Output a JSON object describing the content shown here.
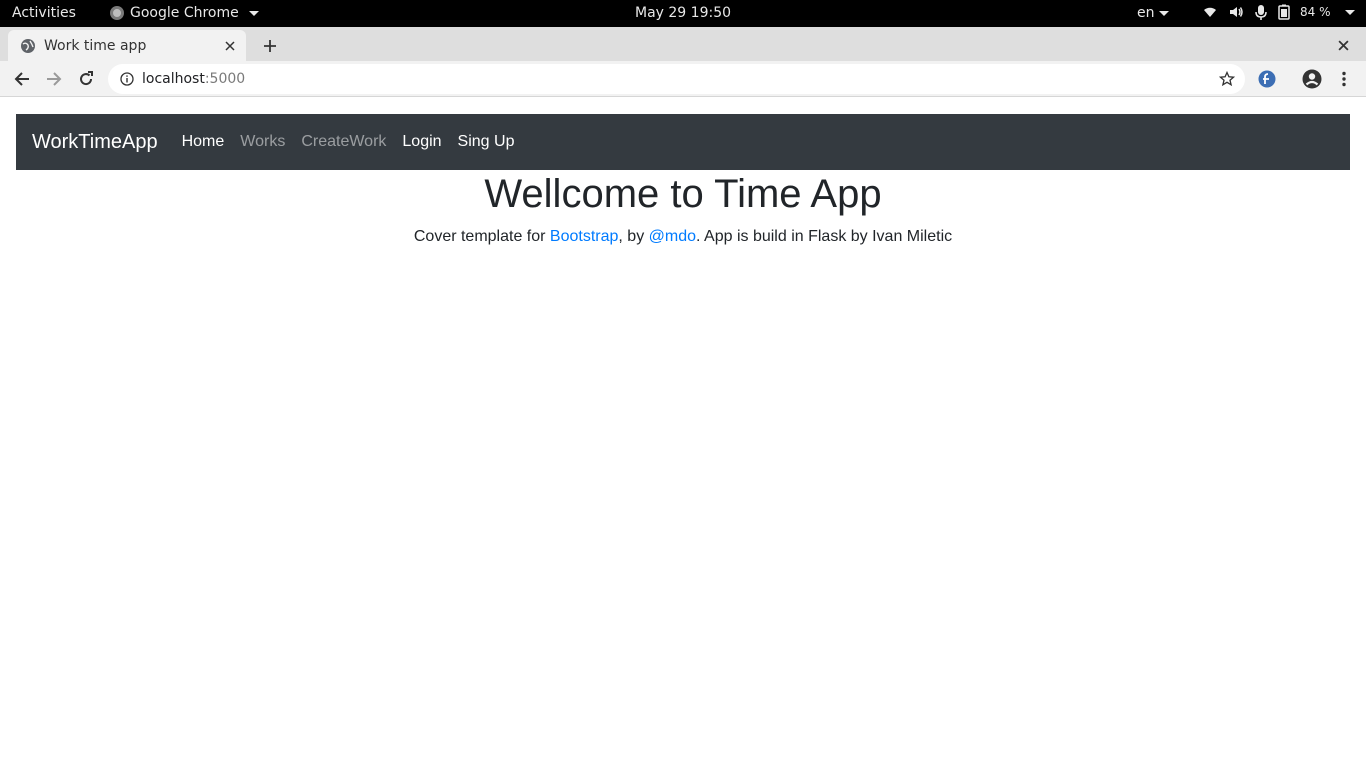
{
  "system_bar": {
    "activities": "Activities",
    "app_name": "Google Chrome",
    "clock": "May 29  19:50",
    "language": "en",
    "battery": "84 %"
  },
  "browser": {
    "tab_title": "Work time app",
    "url_host": "localhost",
    "url_port": ":5000"
  },
  "navbar": {
    "brand": "WorkTimeApp",
    "links": [
      {
        "label": "Home",
        "state": "active"
      },
      {
        "label": "Works",
        "state": "muted"
      },
      {
        "label": "CreateWork",
        "state": "muted"
      },
      {
        "label": "Login",
        "state": "active"
      },
      {
        "label": "Sing Up",
        "state": "active"
      }
    ]
  },
  "main": {
    "title": "Wellcome to Time App",
    "lead_prefix": "Cover template for ",
    "bootstrap_link": "Bootstrap",
    "lead_mid": ", by ",
    "mdo_link": "@mdo",
    "lead_suffix": ". App is build in Flask by Ivan Miletic"
  },
  "colors": {
    "navbar_bg": "#343a40",
    "link": "#007bff",
    "text": "#212529"
  }
}
